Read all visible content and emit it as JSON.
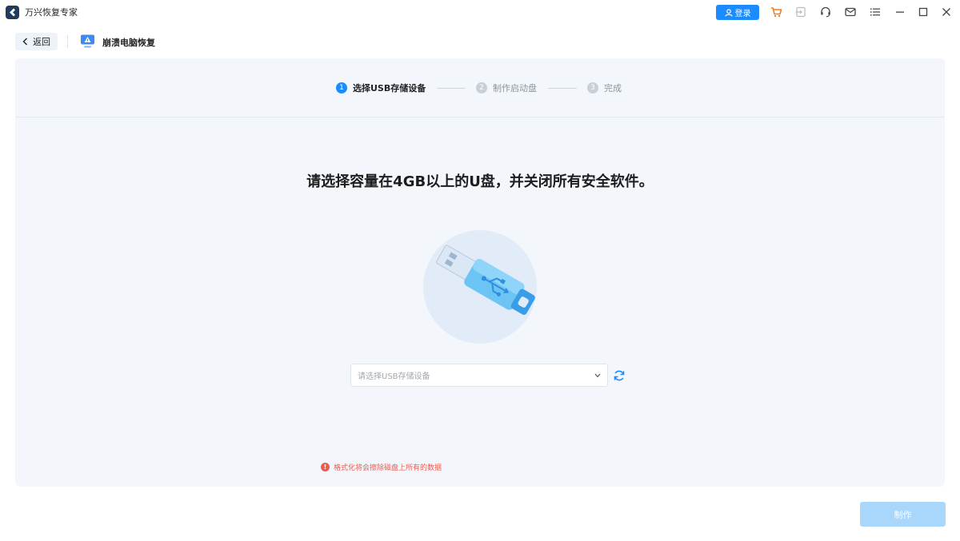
{
  "window": {
    "app_title": "万兴恢复专家",
    "login_label": "登录",
    "toolbar_icons": [
      "cart-icon",
      "sign-in-icon",
      "headset-icon",
      "mail-icon",
      "menu-icon",
      "minimize-icon",
      "maximize-icon",
      "close-icon"
    ]
  },
  "nav": {
    "back_label": "返回",
    "module_title": "崩溃电脑恢复"
  },
  "steps": [
    {
      "number": "1",
      "label": "选择USB存储设备",
      "state": "active"
    },
    {
      "number": "2",
      "label": "制作启动盘",
      "state": "inactive"
    },
    {
      "number": "3",
      "label": "完成",
      "state": "inactive"
    }
  ],
  "main": {
    "headline": "请选择容量在4GB以上的U盘，并关闭所有安全软件。",
    "device_select_placeholder": "请选择USB存储设备",
    "warning_text": "格式化将会擦除磁盘上所有的数据",
    "make_button_label": "制作"
  },
  "colors": {
    "accent": "#1a8cff",
    "warning": "#f05a4e",
    "cart": "#ff7a1a",
    "disabled_button": "#a9d6fb"
  }
}
